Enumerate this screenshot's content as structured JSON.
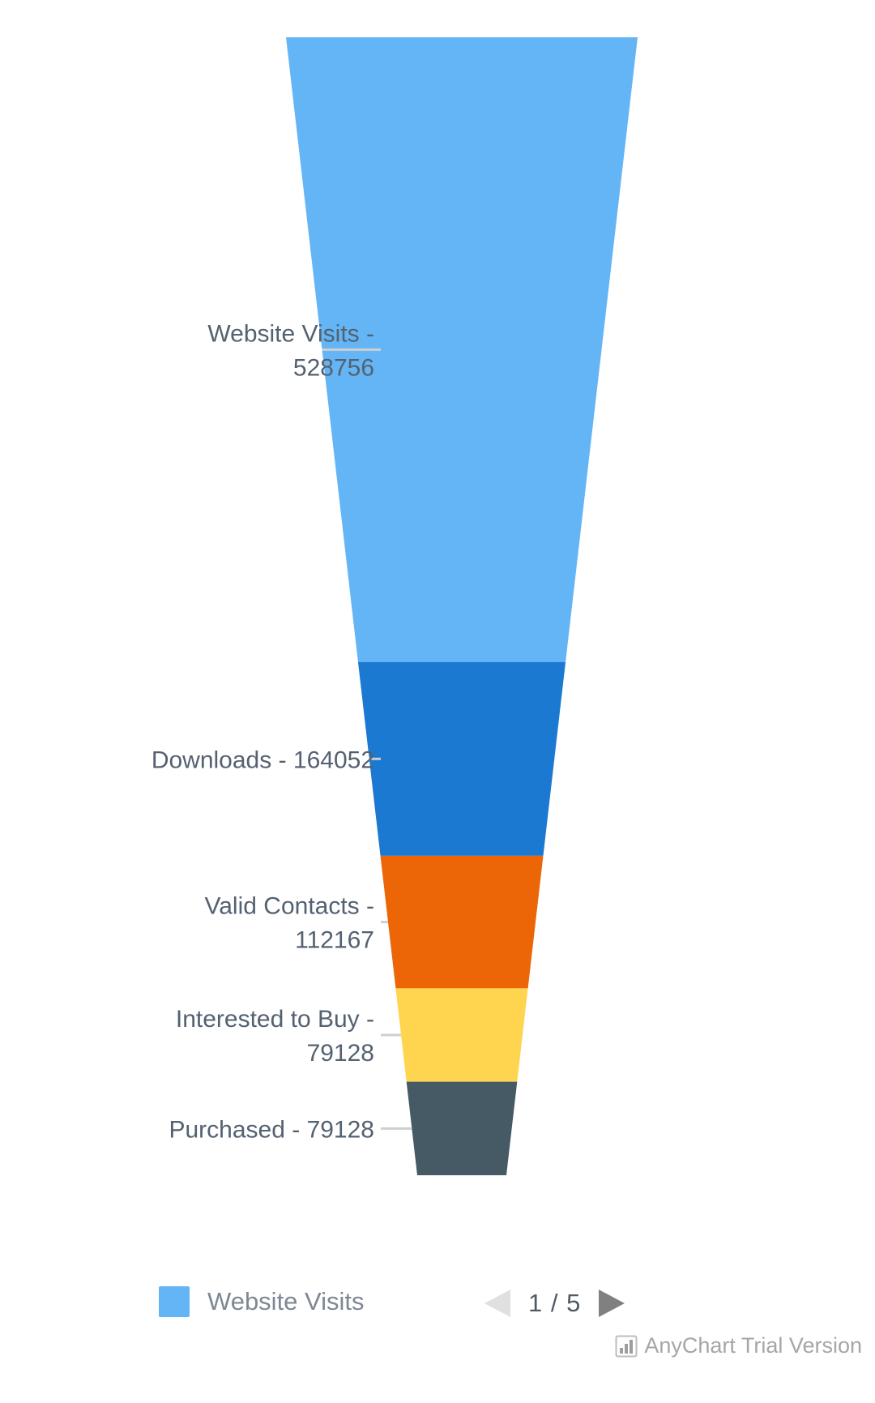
{
  "chart_data": {
    "type": "funnel",
    "title": "",
    "categories": [
      "Website Visits",
      "Downloads",
      "Valid Contacts",
      "Interested to Buy",
      "Purchased"
    ],
    "values": [
      528756,
      164052,
      112167,
      79128,
      79128
    ],
    "labels": [
      "Website Visits - 528756",
      "Downloads - 164052",
      "Valid Contacts - 112167",
      "Interested to Buy - 79128",
      "Purchased - 79128"
    ],
    "colors": [
      "#64b5f6",
      "#1b79d2",
      "#ec6608",
      "#ffd54f",
      "#455a64"
    ],
    "label_position": "outside-left",
    "legend_position": "bottom"
  },
  "legend": {
    "items": [
      {
        "label": "Website Visits",
        "color": "#64b5f6"
      }
    ]
  },
  "pager": {
    "prev_icon": "triangle-left-icon",
    "next_icon": "triangle-right-icon",
    "count_text": "1 / 5",
    "current_page": 1,
    "total_pages": 5,
    "prev_enabled": false,
    "next_enabled": true
  },
  "credits": {
    "icon": "bar-chart-icon",
    "text": "AnyChart Trial Version"
  }
}
